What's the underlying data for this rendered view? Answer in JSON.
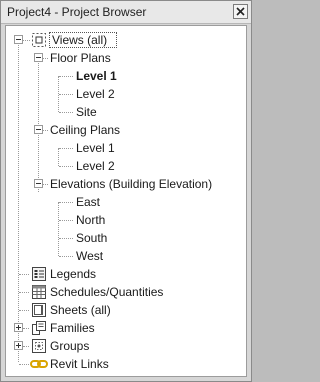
{
  "window": {
    "title": "Project4 - Project Browser"
  },
  "tree": {
    "views": "Views (all)",
    "floor_plans": "Floor Plans",
    "floor_plans_items": [
      "Level 1",
      "Level 2",
      "Site"
    ],
    "ceiling_plans": "Ceiling Plans",
    "ceiling_plans_items": [
      "Level 1",
      "Level 2"
    ],
    "elevations": "Elevations (Building Elevation)",
    "elevations_items": [
      "East",
      "North",
      "South",
      "West"
    ],
    "legends": "Legends",
    "schedules": "Schedules/Quantities",
    "sheets": "Sheets (all)",
    "families": "Families",
    "groups": "Groups",
    "revit_links": "Revit Links"
  },
  "icons": {
    "views": "view-icon",
    "legends": "legend-icon",
    "schedules": "schedule-icon",
    "sheets": "sheet-icon",
    "families": "family-icon",
    "groups": "group-icon",
    "revit_links": "link-icon"
  },
  "colors": {
    "link_icon": "#d9a400",
    "panel_bg": "#ffffff",
    "window_bg": "#d6d6d6"
  }
}
